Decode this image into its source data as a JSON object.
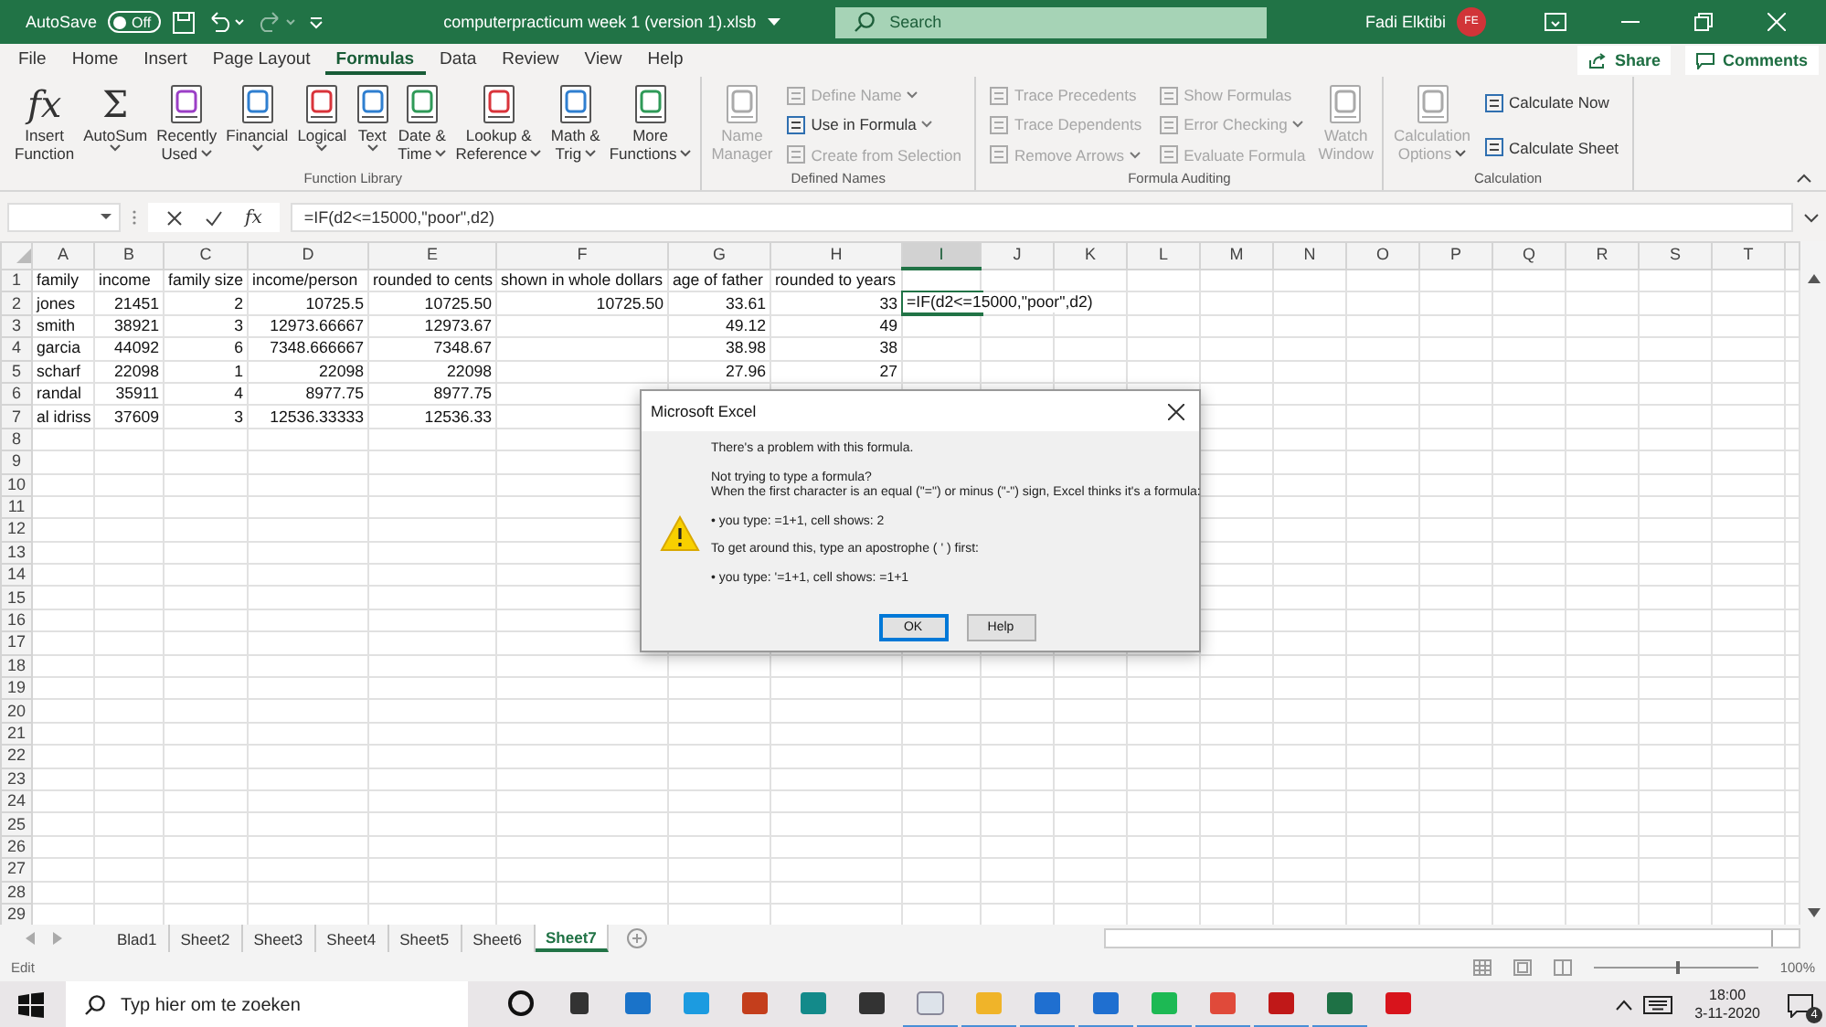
{
  "title_bar": {
    "autosave_label": "AutoSave",
    "autosave_toggle": {
      "label": "Off",
      "on": false
    },
    "filename": "computerpracticum week 1 (version 1).xlsb",
    "search_placeholder": "Search",
    "user_name": "Fadi Elktibi",
    "avatar_initials": "FE"
  },
  "menu_tabs": [
    {
      "label": "File",
      "selected": false
    },
    {
      "label": "Home",
      "selected": false
    },
    {
      "label": "Insert",
      "selected": false
    },
    {
      "label": "Page Layout",
      "selected": false
    },
    {
      "label": "Formulas",
      "selected": true
    },
    {
      "label": "Data",
      "selected": false
    },
    {
      "label": "Review",
      "selected": false
    },
    {
      "label": "View",
      "selected": false
    },
    {
      "label": "Help",
      "selected": false
    }
  ],
  "share_button": "Share",
  "comments_button": "Comments",
  "ribbon_groups": [
    {
      "label": "Function Library",
      "items": [
        {
          "kind": "large",
          "glyph": "fx",
          "lines": [
            "Insert",
            "Function"
          ],
          "dropdown": false,
          "disabled": false
        },
        {
          "kind": "large",
          "glyph": "Σ",
          "lines": [
            "AutoSum"
          ],
          "dropdown": true,
          "disabled": false
        },
        {
          "kind": "large",
          "lines": [
            "Recently",
            "Used"
          ],
          "dropdown": true,
          "disabled": false
        },
        {
          "kind": "large",
          "lines": [
            "Financial"
          ],
          "dropdown": true,
          "disabled": false
        },
        {
          "kind": "large",
          "lines": [
            "Logical"
          ],
          "dropdown": true,
          "disabled": false
        },
        {
          "kind": "large",
          "lines": [
            "Text"
          ],
          "dropdown": true,
          "disabled": false
        },
        {
          "kind": "large",
          "lines": [
            "Date &",
            "Time"
          ],
          "dropdown": true,
          "disabled": false
        },
        {
          "kind": "large",
          "lines": [
            "Lookup &",
            "Reference"
          ],
          "dropdown": true,
          "disabled": false
        },
        {
          "kind": "large",
          "lines": [
            "Math &",
            "Trig"
          ],
          "dropdown": true,
          "disabled": false
        },
        {
          "kind": "large",
          "lines": [
            "More",
            "Functions"
          ],
          "dropdown": true,
          "disabled": false
        }
      ]
    },
    {
      "label": "Defined Names",
      "items": [
        {
          "kind": "large",
          "lines": [
            "Name",
            "Manager"
          ],
          "dropdown": false,
          "disabled": true
        },
        {
          "kind": "stack",
          "entries": [
            {
              "label": "Define Name",
              "dropdown": true,
              "disabled": true
            },
            {
              "label": "Use in Formula",
              "dropdown": true,
              "disabled": false
            },
            {
              "label": "Create from Selection",
              "dropdown": false,
              "disabled": true
            }
          ]
        }
      ]
    },
    {
      "label": "Formula Auditing",
      "items": [
        {
          "kind": "stack",
          "entries": [
            {
              "label": "Trace Precedents",
              "dropdown": false,
              "disabled": true
            },
            {
              "label": "Trace Dependents",
              "dropdown": false,
              "disabled": true
            },
            {
              "label": "Remove Arrows",
              "dropdown": true,
              "disabled": true
            }
          ]
        },
        {
          "kind": "stack",
          "entries": [
            {
              "label": "Show Formulas",
              "dropdown": false,
              "disabled": true
            },
            {
              "label": "Error Checking",
              "dropdown": true,
              "disabled": true
            },
            {
              "label": "Evaluate Formula",
              "dropdown": false,
              "disabled": true
            }
          ]
        },
        {
          "kind": "large",
          "lines": [
            "Watch",
            "Window"
          ],
          "dropdown": false,
          "disabled": true
        }
      ]
    },
    {
      "label": "Calculation",
      "items": [
        {
          "kind": "large",
          "lines": [
            "Calculation",
            "Options"
          ],
          "dropdown": true,
          "disabled": true
        },
        {
          "kind": "stack",
          "entries": [
            {
              "label": "Calculate Now",
              "dropdown": false,
              "disabled": false
            },
            {
              "label": "Calculate Sheet",
              "dropdown": false,
              "disabled": false
            }
          ]
        }
      ]
    }
  ],
  "formula_bar": {
    "insert_function_glyph": "fx",
    "formula": "=IF(d2<=15000,\"poor\",d2)"
  },
  "sheet": {
    "columns": [
      {
        "label": "A",
        "selected": false
      },
      {
        "label": "B",
        "selected": false
      },
      {
        "label": "C",
        "selected": false
      },
      {
        "label": "D",
        "selected": false
      },
      {
        "label": "E",
        "selected": false
      },
      {
        "label": "F",
        "selected": false
      },
      {
        "label": "G",
        "selected": false
      },
      {
        "label": "H",
        "selected": false
      },
      {
        "label": "I",
        "selected": true
      },
      {
        "label": "J",
        "selected": false
      },
      {
        "label": "K",
        "selected": false
      },
      {
        "label": "L",
        "selected": false
      },
      {
        "label": "M",
        "selected": false
      },
      {
        "label": "N",
        "selected": false
      },
      {
        "label": "O",
        "selected": false
      },
      {
        "label": "P",
        "selected": false
      },
      {
        "label": "Q",
        "selected": false
      },
      {
        "label": "R",
        "selected": false
      },
      {
        "label": "S",
        "selected": false
      },
      {
        "label": "T",
        "selected": false
      }
    ],
    "rows": [
      {
        "label": "1",
        "cells": [
          {
            "value": "family",
            "kind": "text"
          },
          {
            "value": "income",
            "kind": "text"
          },
          {
            "value": "family size",
            "kind": "text"
          },
          {
            "value": "income/person",
            "kind": "text"
          },
          {
            "value": "rounded to cents",
            "kind": "text"
          },
          {
            "value": "shown in whole dollars",
            "kind": "text"
          },
          {
            "value": "age of father",
            "kind": "text"
          },
          {
            "value": "rounded to years",
            "kind": "text"
          }
        ]
      },
      {
        "label": "2",
        "cells": [
          {
            "value": "jones",
            "kind": "text"
          },
          {
            "value": "21451",
            "kind": "number"
          },
          {
            "value": "2",
            "kind": "number"
          },
          {
            "value": "10725.5",
            "kind": "number"
          },
          {
            "value": "10725.50",
            "kind": "number"
          },
          {
            "value": "10725.50",
            "kind": "number"
          },
          {
            "value": "33.61",
            "kind": "number"
          },
          {
            "value": "33",
            "kind": "number"
          },
          {
            "value": "=IF(d2<=15000,\"poor\",d2)",
            "kind": "text",
            "active": true
          }
        ]
      },
      {
        "label": "3",
        "cells": [
          {
            "value": "smith",
            "kind": "text"
          },
          {
            "value": "38921",
            "kind": "number"
          },
          {
            "value": "3",
            "kind": "number"
          },
          {
            "value": "12973.66667",
            "kind": "number"
          },
          {
            "value": "12973.67",
            "kind": "number"
          },
          null,
          {
            "value": "49.12",
            "kind": "number"
          },
          {
            "value": "49",
            "kind": "number"
          }
        ]
      },
      {
        "label": "4",
        "cells": [
          {
            "value": "garcia",
            "kind": "text"
          },
          {
            "value": "44092",
            "kind": "number"
          },
          {
            "value": "6",
            "kind": "number"
          },
          {
            "value": "7348.666667",
            "kind": "number"
          },
          {
            "value": "7348.67",
            "kind": "number"
          },
          null,
          {
            "value": "38.98",
            "kind": "number"
          },
          {
            "value": "38",
            "kind": "number"
          }
        ]
      },
      {
        "label": "5",
        "cells": [
          {
            "value": "scharf",
            "kind": "text"
          },
          {
            "value": "22098",
            "kind": "number"
          },
          {
            "value": "1",
            "kind": "number"
          },
          {
            "value": "22098",
            "kind": "number"
          },
          {
            "value": "22098",
            "kind": "number"
          },
          null,
          {
            "value": "27.96",
            "kind": "number"
          },
          {
            "value": "27",
            "kind": "number"
          }
        ]
      },
      {
        "label": "6",
        "cells": [
          {
            "value": "randal",
            "kind": "text"
          },
          {
            "value": "35911",
            "kind": "number"
          },
          {
            "value": "4",
            "kind": "number"
          },
          {
            "value": "8977.75",
            "kind": "number"
          },
          {
            "value": "8977.75",
            "kind": "number"
          }
        ]
      },
      {
        "label": "7",
        "cells": [
          {
            "value": "al idriss",
            "kind": "text"
          },
          {
            "value": "37609",
            "kind": "number"
          },
          {
            "value": "3",
            "kind": "number"
          },
          {
            "value": "12536.33333",
            "kind": "number"
          },
          {
            "value": "12536.33",
            "kind": "number"
          }
        ]
      },
      {
        "label": "8",
        "cells": []
      },
      {
        "label": "9",
        "cells": []
      },
      {
        "label": "10",
        "cells": []
      },
      {
        "label": "11",
        "cells": []
      },
      {
        "label": "12",
        "cells": []
      },
      {
        "label": "13",
        "cells": []
      },
      {
        "label": "14",
        "cells": []
      },
      {
        "label": "15",
        "cells": []
      },
      {
        "label": "16",
        "cells": []
      },
      {
        "label": "17",
        "cells": []
      },
      {
        "label": "18",
        "cells": []
      },
      {
        "label": "19",
        "cells": []
      },
      {
        "label": "20",
        "cells": []
      },
      {
        "label": "21",
        "cells": []
      },
      {
        "label": "22",
        "cells": []
      },
      {
        "label": "23",
        "cells": []
      },
      {
        "label": "24",
        "cells": []
      },
      {
        "label": "25",
        "cells": []
      },
      {
        "label": "26",
        "cells": []
      },
      {
        "label": "27",
        "cells": []
      },
      {
        "label": "28",
        "cells": []
      },
      {
        "label": "29",
        "cells": []
      }
    ]
  },
  "dialog": {
    "title": "Microsoft Excel",
    "paragraphs": [
      [
        "There's a problem with this formula."
      ],
      [
        "Not trying to type a formula?",
        "When the first character is an equal (\"=\") or minus (\"-\") sign, Excel thinks it's a formula:"
      ],
      [
        "• you type:   =1+1, cell shows:   2"
      ],
      [
        "To get around this, type an apostrophe ( ' ) first:"
      ],
      [
        "• you type:   '=1+1, cell shows:   =1+1"
      ]
    ],
    "buttons": [
      {
        "label": "OK",
        "default": true
      },
      {
        "label": "Help",
        "default": false
      }
    ]
  },
  "sheet_tabs": [
    {
      "label": "Blad1",
      "selected": false
    },
    {
      "label": "Sheet2",
      "selected": false
    },
    {
      "label": "Sheet3",
      "selected": false
    },
    {
      "label": "Sheet4",
      "selected": false
    },
    {
      "label": "Sheet5",
      "selected": false
    },
    {
      "label": "Sheet6",
      "selected": false
    },
    {
      "label": "Sheet7",
      "selected": true
    }
  ],
  "status_bar": {
    "mode": "Edit",
    "zoom_slider": {
      "level": 0.5
    },
    "zoom": "100%"
  },
  "taskbar": {
    "search_placeholder": "Typ hier om te zoeken",
    "apps": [
      {
        "running": false
      },
      {
        "running": false
      },
      {
        "running": false
      },
      {
        "running": false
      },
      {
        "running": false
      },
      {
        "running": false
      },
      {
        "running": false
      },
      {
        "running": true
      },
      {
        "running": true
      },
      {
        "running": true
      },
      {
        "running": true
      },
      {
        "running": true
      },
      {
        "running": true
      },
      {
        "running": true
      },
      {
        "running": true
      },
      {
        "running": false
      }
    ],
    "time": "18:00",
    "date": "3-11-2020",
    "notification_count": "4"
  }
}
